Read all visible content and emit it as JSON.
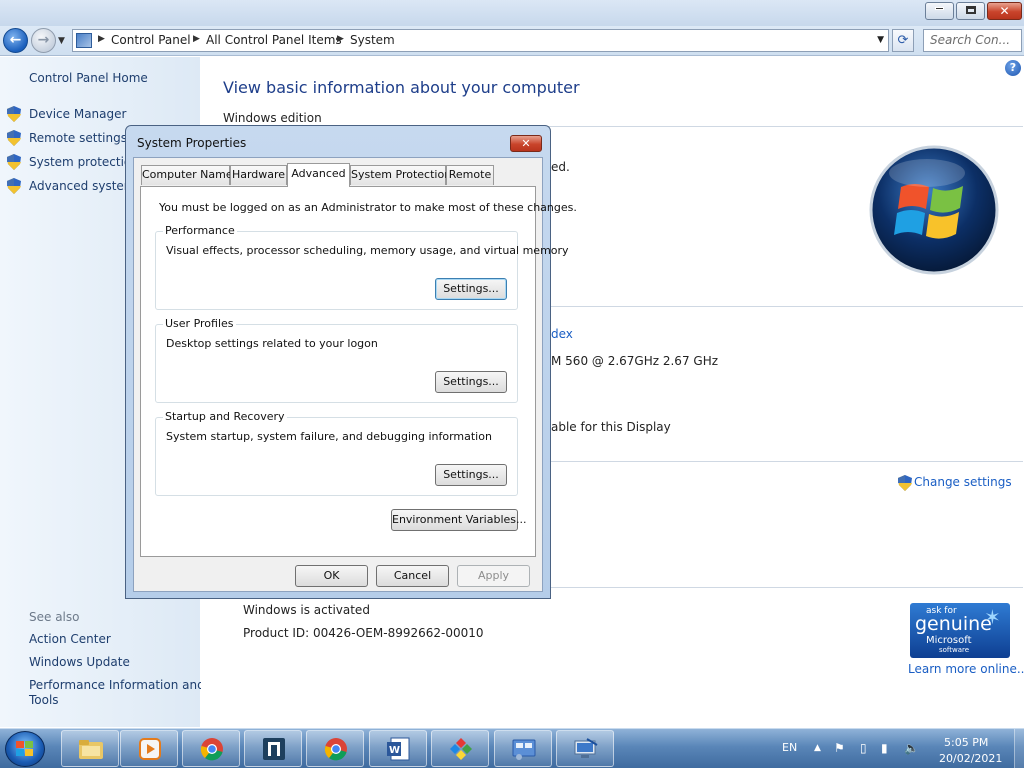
{
  "explorer": {
    "breadcrumb": [
      "Control Panel",
      "All Control Panel Items",
      "System"
    ],
    "search_placeholder": "Search Con..."
  },
  "left_pane": {
    "home": "Control Panel Home",
    "tasks": [
      "Device Manager",
      "Remote settings",
      "System protection",
      "Advanced system"
    ],
    "see_also_label": "See also",
    "see_also": [
      "Action Center",
      "Windows Update",
      "Performance Information and",
      "Tools"
    ]
  },
  "main": {
    "title": "View basic information about your computer",
    "edition_header": "Windows edition",
    "fragments": {
      "edition_tail": "ed.",
      "rating_tail": "dex",
      "processor_tail": "M 560  @ 2.67GHz   2.67 GHz",
      "pen_tail": "able for this Display"
    },
    "change_settings": "Change settings",
    "activation": "Windows is activated",
    "product_id": "Product ID: 00426-OEM-8992662-00010",
    "genuine": {
      "l1": "ask for",
      "l2": "genuine",
      "l3": "Microsoft",
      "l4": "software"
    },
    "learn_more": "Learn more online..."
  },
  "dialog": {
    "title": "System Properties",
    "tabs": [
      "Computer Name",
      "Hardware",
      "Advanced",
      "System Protection",
      "Remote"
    ],
    "active_tab": "Advanced",
    "admin_note": "You must be logged on as an Administrator to make most of these changes.",
    "groups": [
      {
        "title": "Performance",
        "desc": "Visual effects, processor scheduling, memory usage, and virtual memory",
        "button": "Settings..."
      },
      {
        "title": "User Profiles",
        "desc": "Desktop settings related to your logon",
        "button": "Settings..."
      },
      {
        "title": "Startup and Recovery",
        "desc": "System startup, system failure, and debugging information",
        "button": "Settings..."
      }
    ],
    "env_button": "Environment Variables...",
    "ok": "OK",
    "cancel": "Cancel",
    "apply": "Apply"
  },
  "taskbar": {
    "apps": [
      "windows-explorer",
      "media-player",
      "chrome",
      "app-bracket",
      "chrome",
      "word",
      "paint-shapes",
      "control-panel",
      "remote-desktop"
    ],
    "lang": "EN",
    "time": "5:05 PM",
    "date": "20/02/2021"
  }
}
